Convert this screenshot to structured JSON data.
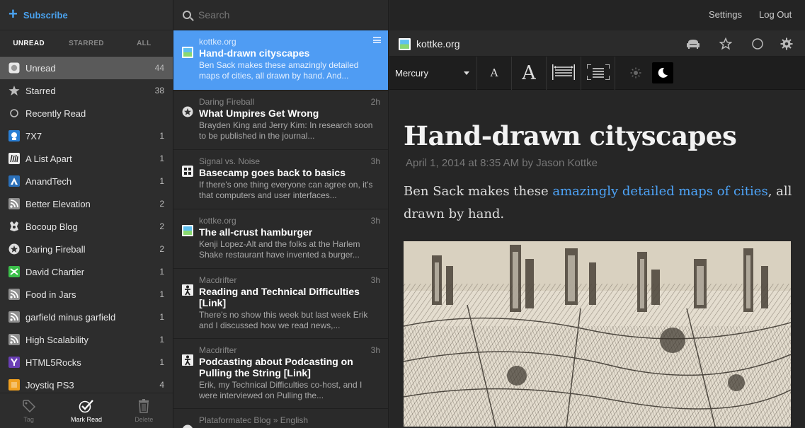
{
  "sidebar": {
    "subscribe_label": "Subscribe",
    "tabs": [
      {
        "label": "UNREAD",
        "active": true
      },
      {
        "label": "STARRED",
        "active": false
      },
      {
        "label": "ALL",
        "active": false
      }
    ],
    "feeds": [
      {
        "name": "Unread",
        "count": "44",
        "icon": "unread-icon",
        "color": "#dddddd",
        "selected": true
      },
      {
        "name": "Starred",
        "count": "38",
        "icon": "star-icon",
        "color": "#bbbbbb"
      },
      {
        "name": "Recently Read",
        "count": "",
        "icon": "circle-icon",
        "color": "#bbbbbb"
      },
      {
        "name": "7X7",
        "count": "1",
        "icon": "7x7-icon",
        "color": "#2a7fd4"
      },
      {
        "name": "A List Apart",
        "count": "1",
        "icon": "alistapart-icon",
        "color": "#eeeeee"
      },
      {
        "name": "AnandTech",
        "count": "1",
        "icon": "anandtech-icon",
        "color": "#2a6fb8"
      },
      {
        "name": "Better Elevation",
        "count": "2",
        "icon": "rss-icon",
        "color": "#999999"
      },
      {
        "name": "Bocoup Blog",
        "count": "2",
        "icon": "bocoup-icon",
        "color": "#dddddd"
      },
      {
        "name": "Daring Fireball",
        "count": "2",
        "icon": "daringfireball-icon",
        "color": "#dddddd"
      },
      {
        "name": "David Chartier",
        "count": "1",
        "icon": "chartier-icon",
        "color": "#3bbf4a"
      },
      {
        "name": "Food in Jars",
        "count": "1",
        "icon": "rss-icon",
        "color": "#999999"
      },
      {
        "name": "garfield minus garfield",
        "count": "1",
        "icon": "rss-icon",
        "color": "#999999"
      },
      {
        "name": "High Scalability",
        "count": "1",
        "icon": "rss-icon",
        "color": "#999999"
      },
      {
        "name": "HTML5Rocks",
        "count": "1",
        "icon": "html5rocks-icon",
        "color": "#6a3fb5"
      },
      {
        "name": "Joystiq PS3",
        "count": "4",
        "icon": "joystiq-icon",
        "color": "#f0a020"
      }
    ],
    "toolbar": [
      {
        "label": "Tag",
        "icon": "tag-icon",
        "active": false
      },
      {
        "label": "Mark Read",
        "icon": "checkmark-icon",
        "active": true
      },
      {
        "label": "Delete",
        "icon": "trash-icon",
        "active": false
      }
    ]
  },
  "search": {
    "placeholder": "Search"
  },
  "articles": [
    {
      "source": "kottke.org",
      "time": "",
      "title": "Hand-drawn cityscapes",
      "snippet": "Ben Sack makes these amazingly detailed maps of cities, all drawn by hand. And...",
      "icon": "kottke-icon",
      "selected": true
    },
    {
      "source": "Daring Fireball",
      "time": "2h",
      "title": "What Umpires Get Wrong",
      "snippet": "Brayden King and Jerry Kim: In research soon to be published in the journal...",
      "icon": "daringfireball-icon"
    },
    {
      "source": "Signal vs. Noise",
      "time": "3h",
      "title": "Basecamp goes back to basics",
      "snippet": "If there's one thing everyone can agree on, it's that computers and user interfaces...",
      "icon": "svn-icon"
    },
    {
      "source": "kottke.org",
      "time": "3h",
      "title": "The all-crust hamburger",
      "snippet": "Kenji Lopez-Alt and the folks at the Harlem Shake restaurant have invented a burger...",
      "icon": "kottke-icon"
    },
    {
      "source": "Macdrifter",
      "time": "3h",
      "title": "Reading and Technical Difficulties [Link]",
      "snippet": "There's no show this week but last week Erik and I discussed how we read news,...",
      "icon": "macdrifter-icon"
    },
    {
      "source": "Macdrifter",
      "time": "3h",
      "title": "Podcasting about Podcasting on Pulling the String [Link]",
      "snippet": "Erik, my Technical Difficulties co-host, and I were interviewed on Pulling the...",
      "icon": "macdrifter-icon"
    },
    {
      "source": "Plataformatec Blog » English",
      "time": "",
      "title": "",
      "snippet": "",
      "icon": "plataformatec-icon"
    }
  ],
  "reader": {
    "settings_label": "Settings",
    "logout_label": "Log Out",
    "feed_name": "kottke.org",
    "font_name": "Mercury",
    "title": "Hand-drawn cityscapes",
    "byline": "April 1, 2014 at 8:35 AM by Jason Kottke",
    "body_before": "Ben Sack makes these ",
    "body_link": "amazingly detailed maps of cities",
    "body_after": ", all drawn by hand.",
    "link_color": "#4da3f7"
  },
  "colors": {
    "accent": "#4f9cf3",
    "selected_feed": "#5a5a5a"
  }
}
